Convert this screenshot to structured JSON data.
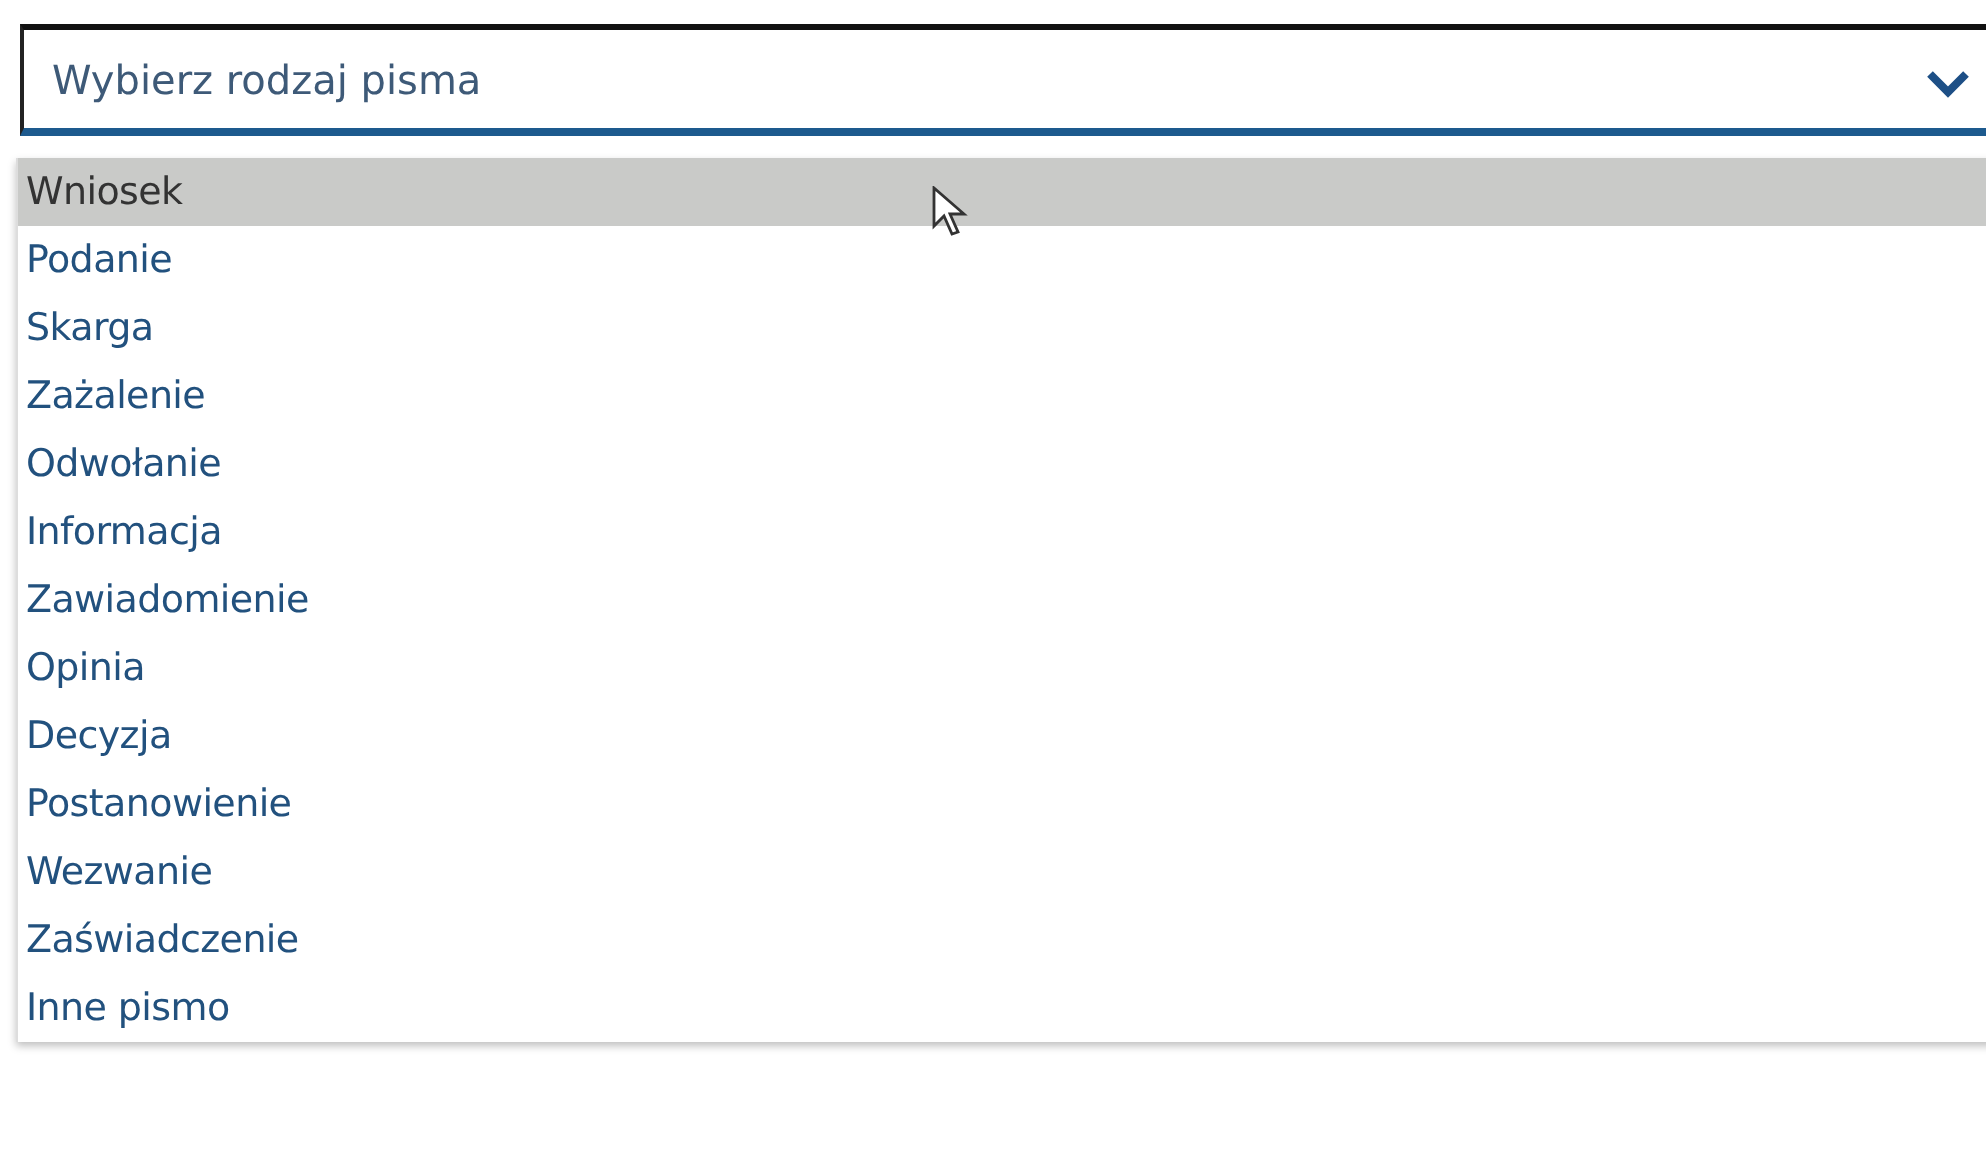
{
  "select": {
    "placeholder": "Wybierz rodzaj pisma",
    "expanded": true
  },
  "options": [
    {
      "label": "Wniosek",
      "selected": true
    },
    {
      "label": "Podanie",
      "selected": false
    },
    {
      "label": "Skarga",
      "selected": false
    },
    {
      "label": "Zażalenie",
      "selected": false
    },
    {
      "label": "Odwołanie",
      "selected": false
    },
    {
      "label": "Informacja",
      "selected": false
    },
    {
      "label": "Zawiadomienie",
      "selected": false
    },
    {
      "label": "Opinia",
      "selected": false
    },
    {
      "label": "Decyzja",
      "selected": false
    },
    {
      "label": "Postanowienie",
      "selected": false
    },
    {
      "label": "Wezwanie",
      "selected": false
    },
    {
      "label": "Zaświadczenie",
      "selected": false
    },
    {
      "label": "Inne pismo",
      "selected": false
    }
  ]
}
